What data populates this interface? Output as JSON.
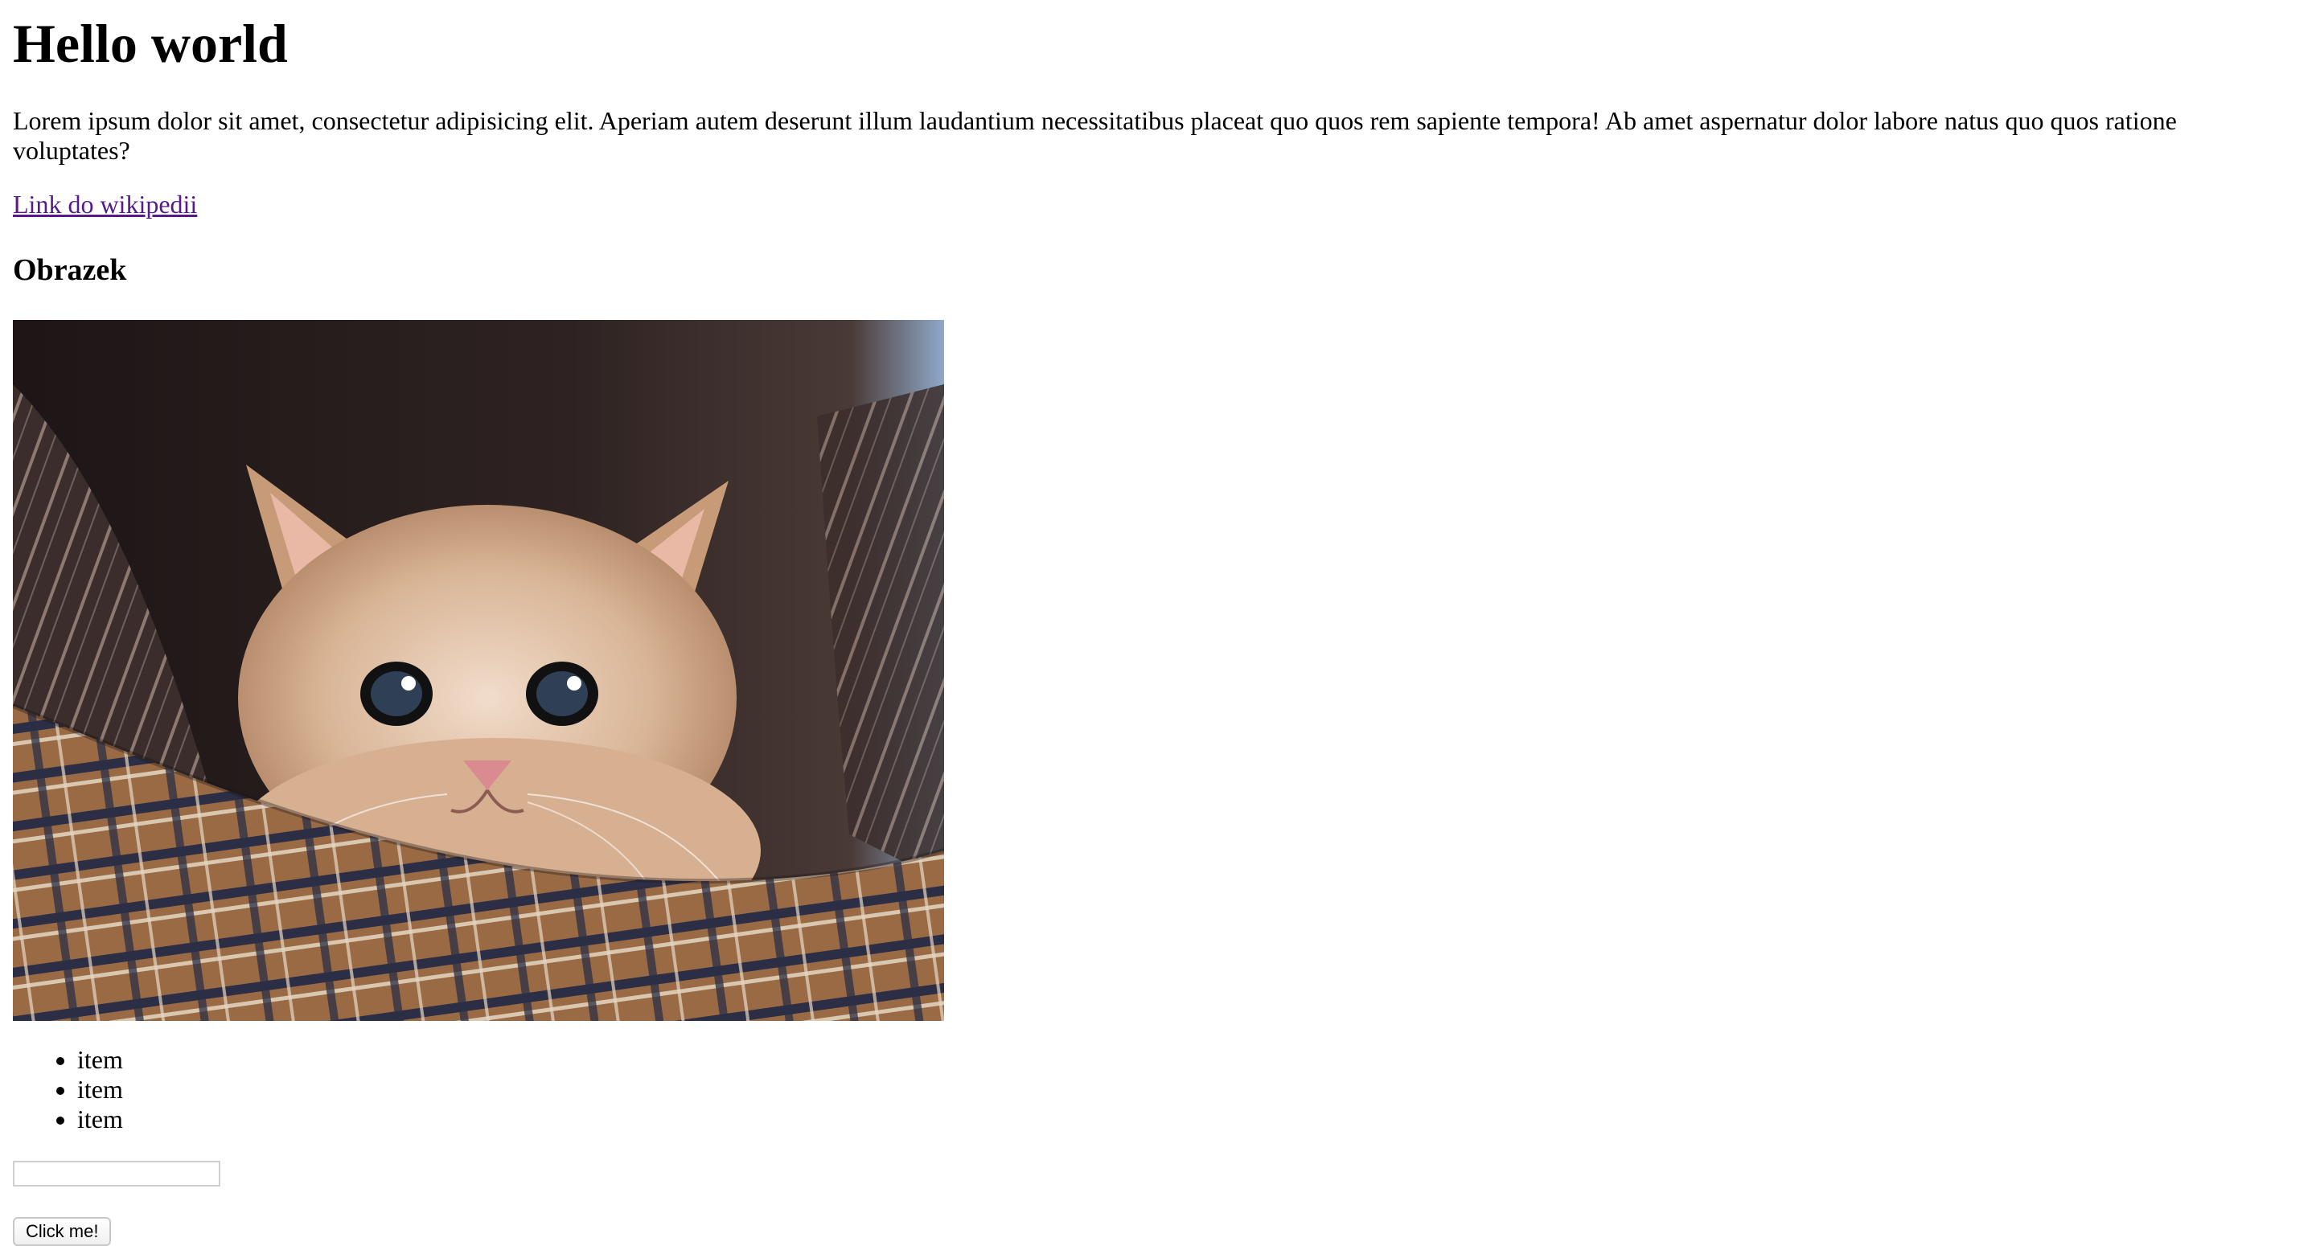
{
  "heading": "Hello world",
  "paragraph": "Lorem ipsum dolor sit amet, consectetur adipisicing elit. Aperiam autem deserunt illum laudantium necessitatibus placeat quo quos rem sapiente tempora! Ab amet aspernatur dolor labore natus quo quos ratione voluptates?",
  "link": {
    "label": "Link do wikipedii",
    "color": "#551a8b"
  },
  "subheading": "Obrazek",
  "image": {
    "subject": "kitten-photo"
  },
  "list": {
    "items": [
      "item",
      "item",
      "item"
    ]
  },
  "input": {
    "value": ""
  },
  "button": {
    "label": "Click me!"
  }
}
